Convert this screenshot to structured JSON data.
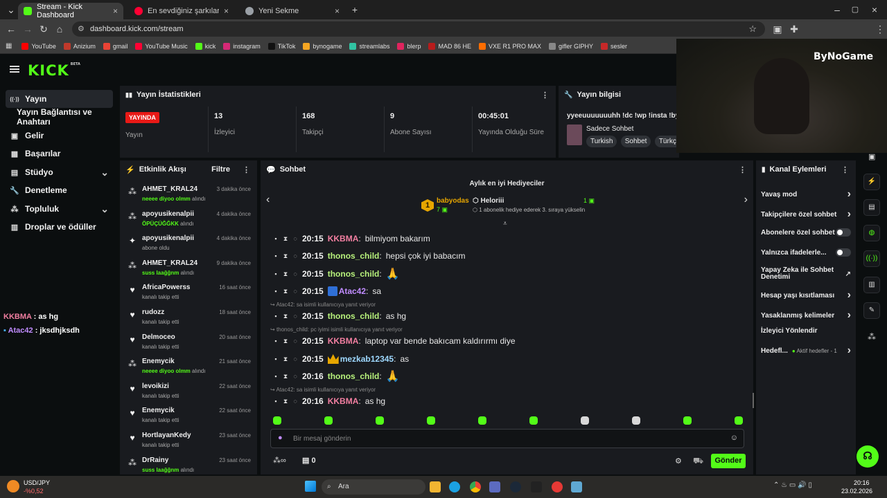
{
  "browser": {
    "tabs": [
      {
        "title": "Stream - Kick Dashboard",
        "favicon_color": "#53fc18"
      },
      {
        "title": "En sevdiğiniz şarkılar ve albümler",
        "favicon_color": "#ff0033"
      },
      {
        "title": "Yeni Sekme",
        "favicon_color": "#9aa0a6"
      }
    ],
    "url": "dashboard.kick.com/stream",
    "bookmarks": [
      {
        "label": "YouTube",
        "color": "#ff0000"
      },
      {
        "label": "Anizium",
        "color": "#c0392b"
      },
      {
        "label": "gmail",
        "color": "#ea4335"
      },
      {
        "label": "YouTube Music",
        "color": "#ff0033"
      },
      {
        "label": "kick",
        "color": "#53fc18"
      },
      {
        "label": "instagram",
        "color": "#d62976"
      },
      {
        "label": "TikTok",
        "color": "#111111"
      },
      {
        "label": "bynogame",
        "color": "#f5a623"
      },
      {
        "label": "streamlabs",
        "color": "#31c3a2"
      },
      {
        "label": "blerp",
        "color": "#e0245e"
      },
      {
        "label": "MAD 86 HE",
        "color": "#b71c1c"
      },
      {
        "label": "VXE R1 PRO MAX",
        "color": "#ff6d00"
      },
      {
        "label": "gifler GIPHY",
        "color": "#888888"
      },
      {
        "label": "sesler",
        "color": "#c62828"
      }
    ]
  },
  "overlay": {
    "watermark": "ByNoGame",
    "chat_lines": [
      {
        "user": "KKBMA",
        "text": "as hg",
        "color": "#f27fa1"
      },
      {
        "user": "Atac42",
        "text": "jksdhjksdh",
        "color": "#c08cff"
      }
    ]
  },
  "brand": {
    "logo": "KICK",
    "beta": "BETA",
    "accent": "#53fc18"
  },
  "sidebar": {
    "items": [
      {
        "label": "Yayın",
        "icon": "broadcast-icon"
      },
      {
        "label": "Yayın Bağlantısı ve Anahtarı",
        "icon": ""
      },
      {
        "label": "Gelir",
        "icon": "wallet-icon"
      },
      {
        "label": "Başarılar",
        "icon": "trophy-icon"
      },
      {
        "label": "Stüdyo",
        "icon": "studio-icon"
      },
      {
        "label": "Denetleme",
        "icon": "wrench-icon"
      },
      {
        "label": "Topluluk",
        "icon": "community-icon"
      },
      {
        "label": "Droplar ve ödüller",
        "icon": "gift-icon"
      }
    ]
  },
  "stats": {
    "title": "Yayın İstatistikleri",
    "live_badge": "YAYINDA",
    "status_label": "Yayın",
    "items": [
      {
        "value": "13",
        "label": "İzleyici"
      },
      {
        "value": "168",
        "label": "Takipçi"
      },
      {
        "value": "9",
        "label": "Abone Sayısı"
      },
      {
        "value": "00:45:01",
        "label": "Yayında Olduğu Süre"
      }
    ]
  },
  "stream_info": {
    "title": "Yayın bilgisi",
    "stream_title": "yyeeuuuuuuuhh !dc !wp !insta !byn",
    "category": "Sadece Sohbet",
    "tags": [
      "Turkish",
      "Sohbet",
      "Türkçe"
    ]
  },
  "activity": {
    "title": "Etkinlik Akışı",
    "filter": "Filtre",
    "events": [
      {
        "user": "AHMET_KRAL24",
        "time": "3 dakika önce",
        "gift": "neeee diyoo olmm",
        "suffix": " alındı",
        "icon": "gift-icon"
      },
      {
        "user": "apoyusikenalpii",
        "time": "4 dakika önce",
        "gift": "ÖPÜÇÜĞĞKK",
        "suffix": " alındı",
        "icon": "gift-icon"
      },
      {
        "user": "apoyusikenalpii",
        "time": "4 dakika önce",
        "gift": "",
        "suffix": "abone oldu",
        "icon": "sparkle-icon"
      },
      {
        "user": "AHMET_KRAL24",
        "time": "9 dakika önce",
        "gift": "suss laağğnm",
        "suffix": " alındı",
        "icon": "gift-icon"
      },
      {
        "user": "AfricaPowerss",
        "time": "16 saat önce",
        "gift": "",
        "suffix": "kanalı takip etti",
        "icon": "heart-icon"
      },
      {
        "user": "rudozz",
        "time": "18 saat önce",
        "gift": "",
        "suffix": "kanalı takip etti",
        "icon": "heart-icon"
      },
      {
        "user": "Delmoceo",
        "time": "20 saat önce",
        "gift": "",
        "suffix": "kanalı takip etti",
        "icon": "heart-icon"
      },
      {
        "user": "Enemycik",
        "time": "21 saat önce",
        "gift": "neeee diyoo olmm",
        "suffix": " alındı",
        "icon": "gift-icon"
      },
      {
        "user": "levoikizi",
        "time": "22 saat önce",
        "gift": "",
        "suffix": "kanalı takip etti",
        "icon": "heart-icon"
      },
      {
        "user": "Enemycik",
        "time": "22 saat önce",
        "gift": "",
        "suffix": "kanalı takip etti",
        "icon": "heart-icon"
      },
      {
        "user": "HortlayanKedy",
        "time": "23 saat önce",
        "gift": "",
        "suffix": "kanalı takip etti",
        "icon": "heart-icon"
      },
      {
        "user": "DrRainy",
        "time": "23 saat önce",
        "gift": "suss laağğnm",
        "suffix": " alındı",
        "icon": "gift-icon"
      }
    ]
  },
  "chat": {
    "title": "Sohbet",
    "leaderboard_title": "Aylık en iyi Hediyeciler",
    "top_gifter": {
      "rank": "1",
      "user": "babyodas",
      "count": "7"
    },
    "second_gifter": {
      "user": "Heloriii",
      "count": "1",
      "note": "1 abonelik hediye ederek 3. sıraya yükselin"
    },
    "messages": [
      {
        "time": "20:15",
        "user": "KKBMA",
        "color": "#f27fa1",
        "text": "bilmiyom bakarım",
        "reply": ""
      },
      {
        "time": "20:15",
        "user": "thonos_child",
        "color": "#b8f27c",
        "text": "hepsi çok iyi babacım",
        "reply": ""
      },
      {
        "time": "20:15",
        "user": "thonos_child",
        "color": "#b8f27c",
        "text": "🙏",
        "reply": ""
      },
      {
        "time": "20:15",
        "user": "Atac42",
        "color": "#c08cff",
        "text": "sa",
        "reply": ""
      },
      {
        "time": "20:15",
        "user": "thonos_child",
        "color": "#b8f27c",
        "text": "as hg",
        "reply": "Atac42: sa isimli kullanıcıya yanıt veriyor"
      },
      {
        "time": "20:15",
        "user": "KKBMA",
        "color": "#f27fa1",
        "text": "laptop var bende bakıcam kaldırırmı diye",
        "reply": "thonos_child: pc iyimi isimli kullanıcıya yanıt veriyor"
      },
      {
        "time": "20:15",
        "user": "mezkab12345",
        "color": "#9ed8ff",
        "text": "as",
        "reply": ""
      },
      {
        "time": "20:16",
        "user": "thonos_child",
        "color": "#b8f27c",
        "text": "🙏",
        "reply": ""
      },
      {
        "time": "20:16",
        "user": "KKBMA",
        "color": "#f27fa1",
        "text": "as hg",
        "reply": "Atac42: sa isimli kullanıcıya yanıt veriyor"
      }
    ],
    "input_placeholder": "Bir mesaj gönderin",
    "points": "0",
    "send": "Gönder"
  },
  "channel_actions": {
    "title": "Kanal Eylemleri",
    "items": [
      {
        "label": "Yavaş mod",
        "kind": "chevron"
      },
      {
        "label": "Takipçilere özel sohbet",
        "kind": "chevron"
      },
      {
        "label": "Abonelere özel sohbet",
        "kind": "toggle"
      },
      {
        "label": "Yalnızca ifadelerle...",
        "kind": "toggle"
      },
      {
        "label": "Yapay Zeka ile Sohbet Denetimi",
        "kind": "external"
      },
      {
        "label": "Hesap yaşı kısıtlaması",
        "kind": "chevron"
      },
      {
        "label": "Yasaklanmış kelimeler",
        "kind": "chevron"
      },
      {
        "label": "İzleyici Yönlendir",
        "kind": "none"
      },
      {
        "label": "Hedefl...",
        "kind": "chevron",
        "extra": "Aktif hedefler - 1"
      }
    ]
  },
  "taskbar": {
    "ticker": "USD/JPY",
    "ticker_change": "-%0,52",
    "search": "Ara",
    "time": "20:16",
    "date": "23.02.2026"
  }
}
